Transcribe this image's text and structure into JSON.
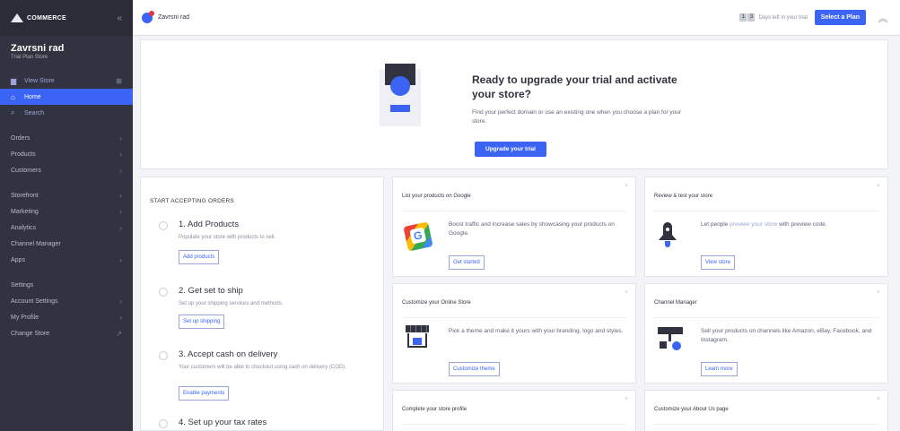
{
  "sidebar": {
    "brand": "COMMERCE",
    "collapse_icon": "«",
    "store_name": "Zavrsni rad",
    "store_plan": "Trial Plan Store",
    "view_store": "View Store",
    "home": "Home",
    "search": "Search",
    "group1": [
      "Orders",
      "Products",
      "Customers"
    ],
    "group2": [
      "Storefront",
      "Marketing",
      "Analytics",
      "Channel Manager",
      "Apps"
    ],
    "group3": [
      "Settings",
      "Account Settings",
      "My Profile",
      "Change Store"
    ]
  },
  "topbar": {
    "store_name": "Zavrsni rad",
    "days_digits": [
      "1",
      "3"
    ],
    "days_text": "Days left in your trial",
    "select_plan": "Select a Plan"
  },
  "banner": {
    "title": "Ready to upgrade your trial and activate your store?",
    "text": "Find your perfect domain or use an existing one when you choose a plan for your store.",
    "button": "Upgrade your trial"
  },
  "checklist": {
    "title": "START ACCEPTING ORDERS",
    "steps": [
      {
        "title": "1. Add Products",
        "desc": "Populate your store with products to sell.",
        "button": "Add products"
      },
      {
        "title": "2. Get set to ship",
        "desc": "Set up your shipping services and methods.",
        "button": "Set up shipping"
      },
      {
        "title": "3. Accept cash on delivery",
        "desc": "Your customers will be able to checkout using cash on delivery (COD).",
        "button": "Enable payments"
      },
      {
        "title": "4. Set up your tax rates",
        "desc": "",
        "button": ""
      }
    ]
  },
  "cards": {
    "google": {
      "title": "List your products on Google",
      "desc": "Boost traffic and increase sales by showcasing your products on Google.",
      "button": "Get started"
    },
    "review": {
      "title": "Review & test your store",
      "desc_pre": "Let people ",
      "desc_link": "preview your store",
      "desc_post": " with preview code.",
      "button": "View store"
    },
    "customize": {
      "title": "Customize your Online Store",
      "desc": "Pick a theme and make it yours with your branding, logo and styles.",
      "button": "Customize theme"
    },
    "channel": {
      "title": "Channel Manager",
      "desc": "Sell your products on channels like Amazon, eBay, Facebook, and Instagram.",
      "button": "Learn more"
    },
    "profile": {
      "title": "Complete your store profile"
    },
    "about": {
      "title": "Customize your About Us page"
    }
  },
  "close_glyph": "×",
  "accent_color": "#3c64f4",
  "sidebar_color": "#313440"
}
